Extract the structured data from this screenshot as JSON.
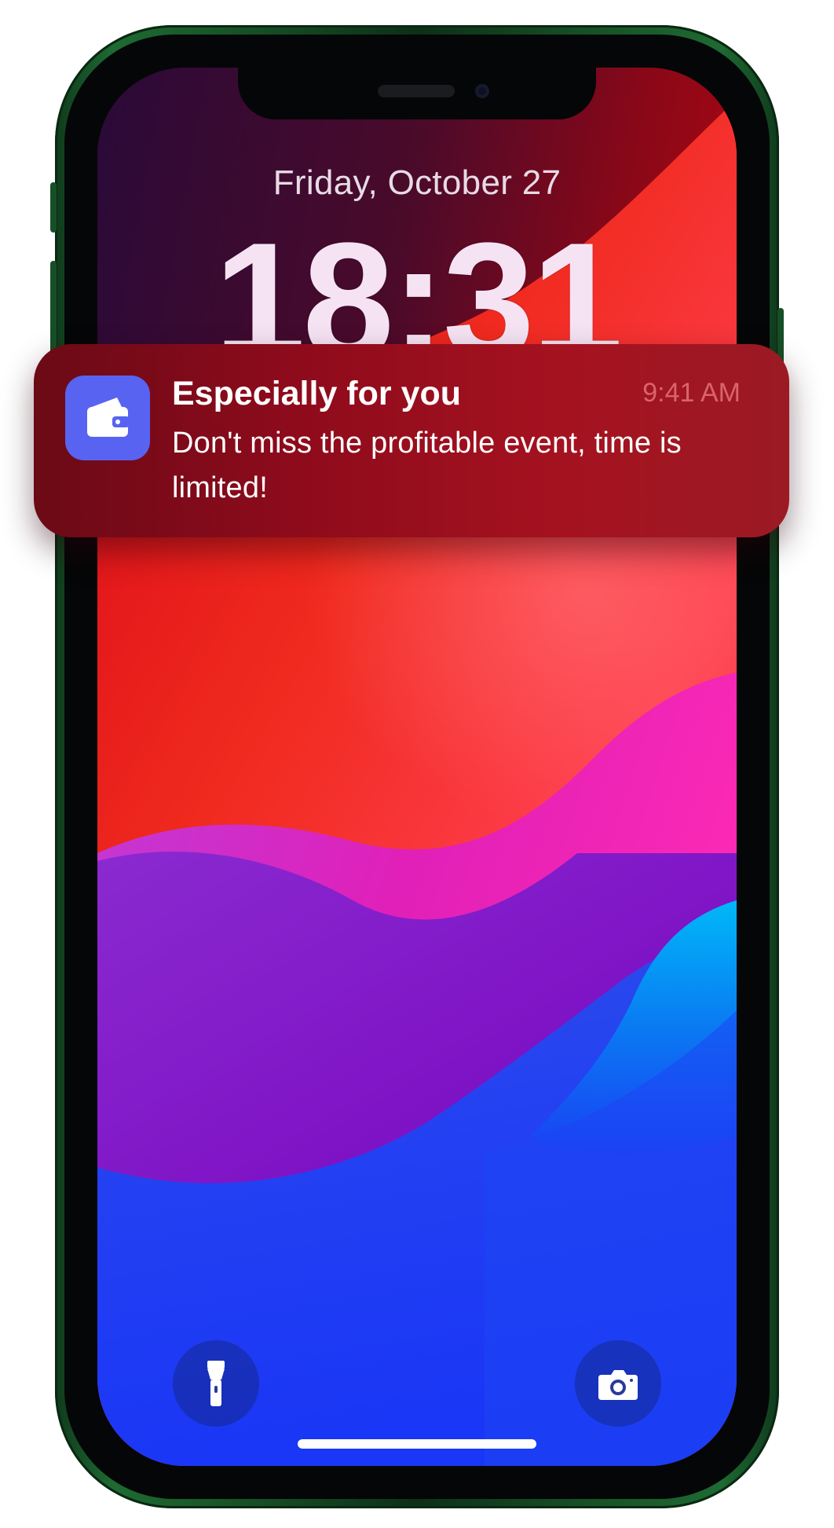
{
  "lock_screen": {
    "date": "Friday, October 27",
    "time": "18:31"
  },
  "notification": {
    "app_icon": "wallet-icon",
    "title": "Especially for you",
    "time": "9:41 AM",
    "body": "Don't miss the profitable event, time is limited!"
  },
  "quick_actions": {
    "left_icon": "flashlight-icon",
    "right_icon": "camera-icon"
  },
  "colors": {
    "phone_frame": "#1e6a32",
    "notification_bg": "#8e0b1c",
    "app_icon_bg": "#5963f2",
    "notification_time": "#d9646d"
  }
}
